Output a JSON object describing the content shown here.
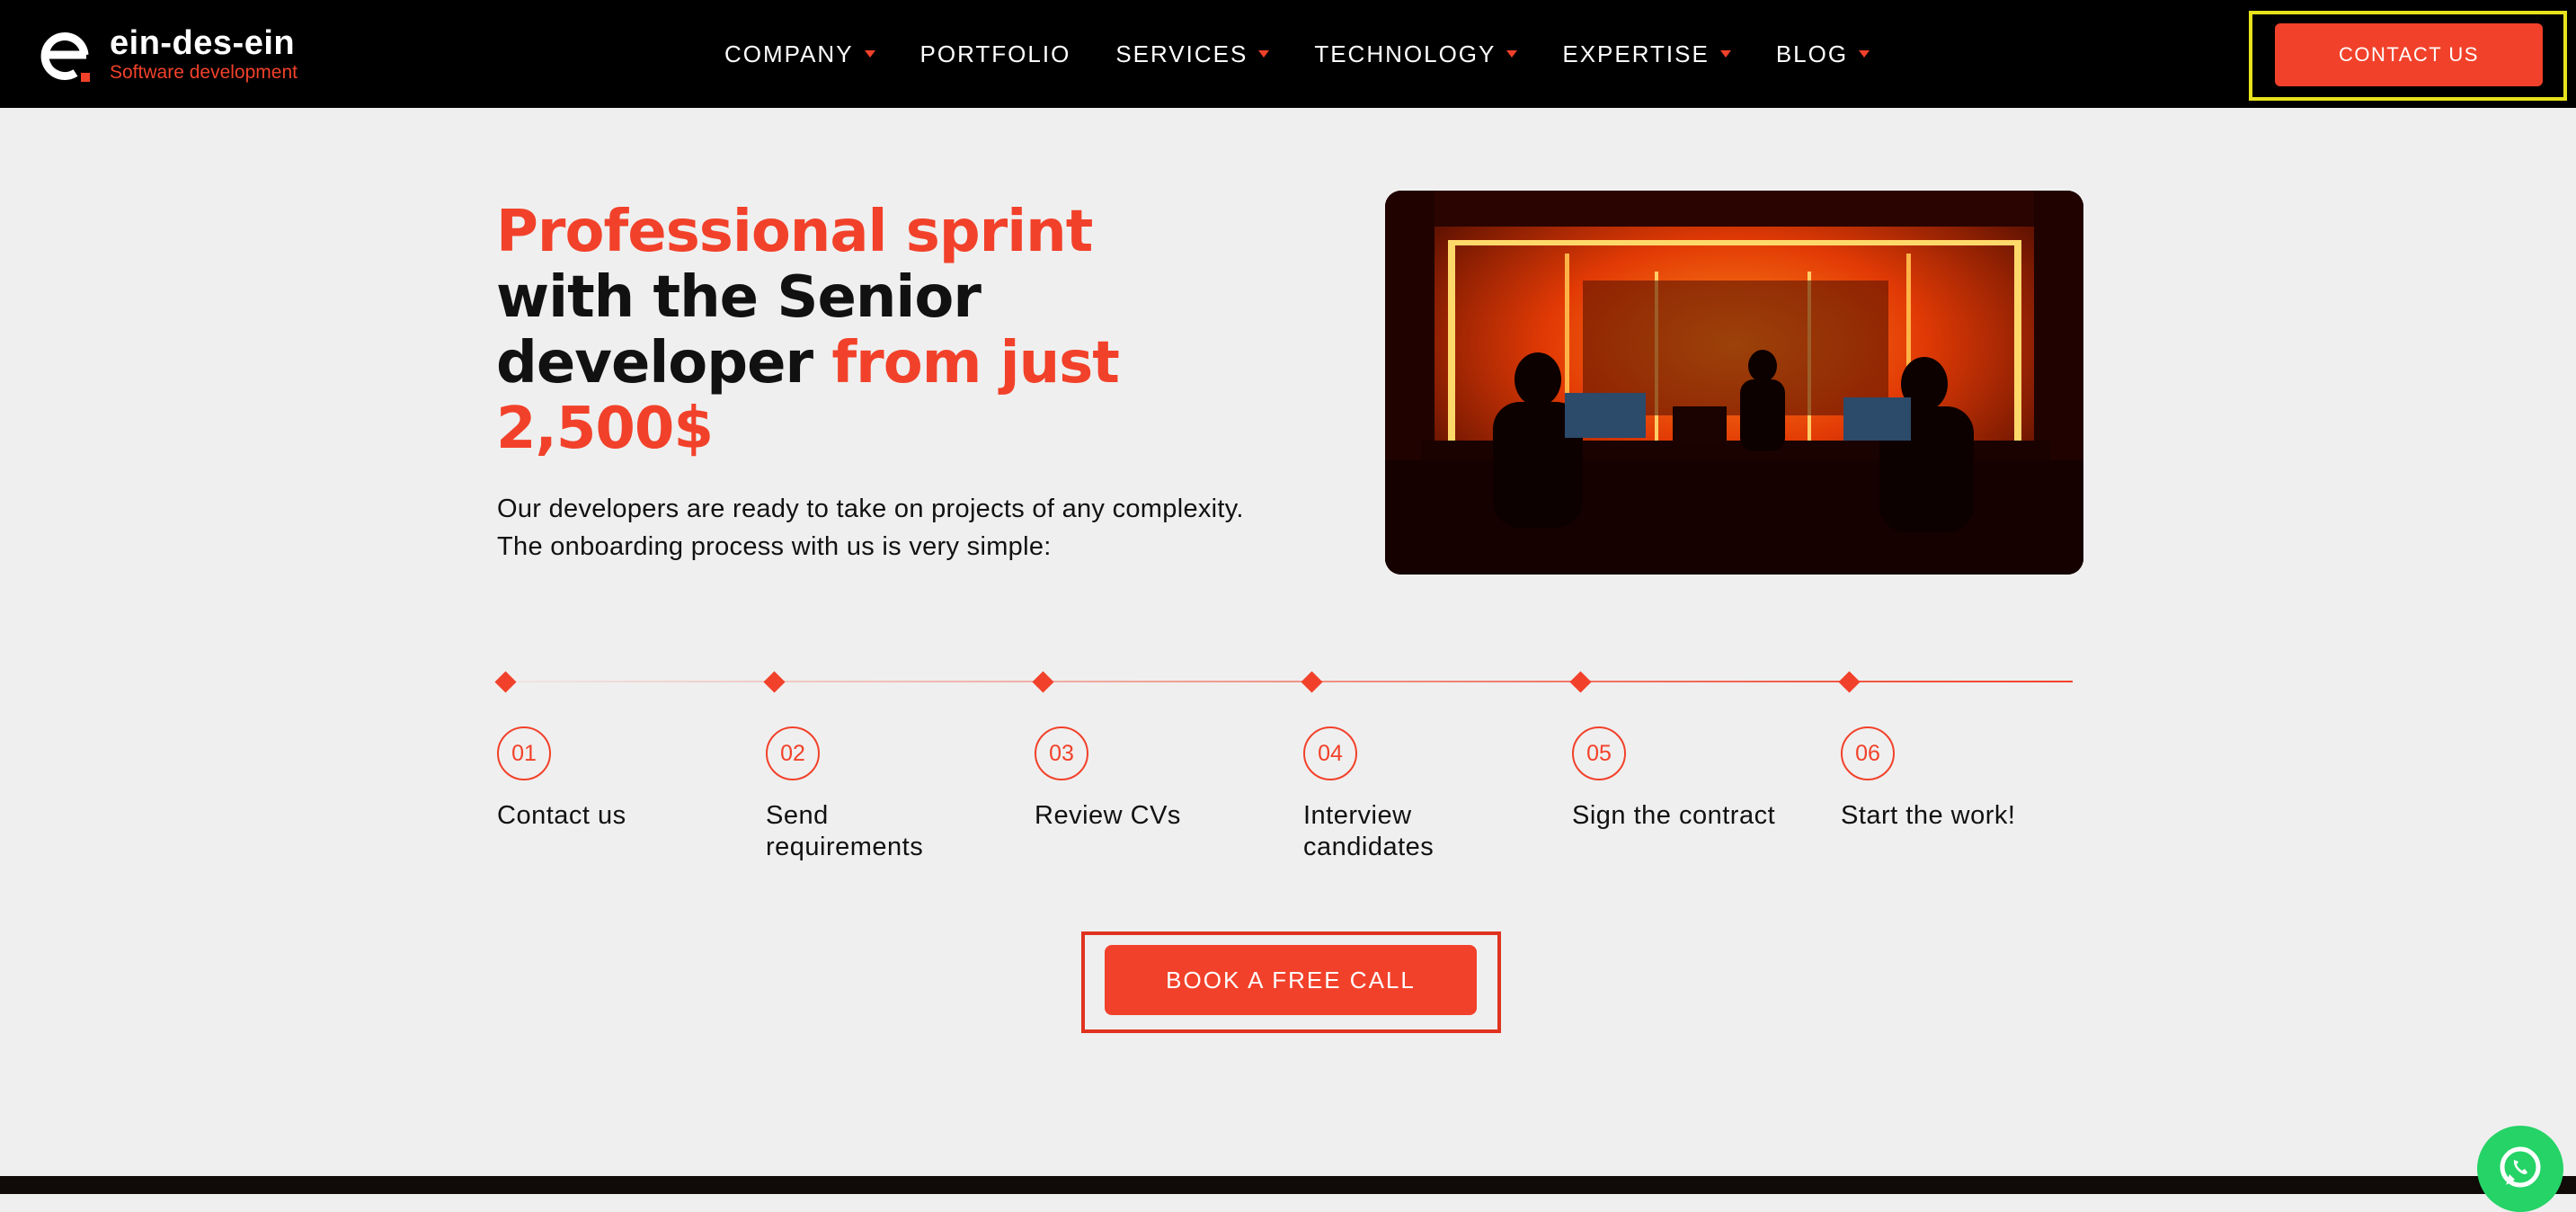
{
  "brand": {
    "name": "ein-des-ein",
    "tagline": "Software development",
    "accent": "#f2412a",
    "logo_icon": "e-letter-logo-icon"
  },
  "nav": {
    "items": [
      {
        "label": "COMPANY",
        "has_dropdown": true
      },
      {
        "label": "PORTFOLIO",
        "has_dropdown": false
      },
      {
        "label": "SERVICES",
        "has_dropdown": true
      },
      {
        "label": "TECHNOLOGY",
        "has_dropdown": true
      },
      {
        "label": "EXPERTISE",
        "has_dropdown": true
      },
      {
        "label": "BLOG",
        "has_dropdown": true
      }
    ],
    "contact_label": "CONTACT US"
  },
  "hero": {
    "title_part1": "Professional sprint",
    "title_part2": "with the Senior",
    "title_part3": "developer",
    "title_part4": "from just",
    "title_part5": "2,500$",
    "description_line1": "Our developers are ready to take on projects of any complexity.",
    "description_line2": "The onboarding process with us is very simple:"
  },
  "steps": [
    {
      "number": "01",
      "label": "Contact us"
    },
    {
      "number": "02",
      "label": "Send requirements"
    },
    {
      "number": "03",
      "label": "Review CVs"
    },
    {
      "number": "04",
      "label": "Interview candidates"
    },
    {
      "number": "05",
      "label": "Sign the contract"
    },
    {
      "number": "06",
      "label": "Start the work!"
    }
  ],
  "cta": {
    "label": "BOOK A FREE CALL"
  },
  "floating": {
    "icon": "whatsapp-icon"
  }
}
